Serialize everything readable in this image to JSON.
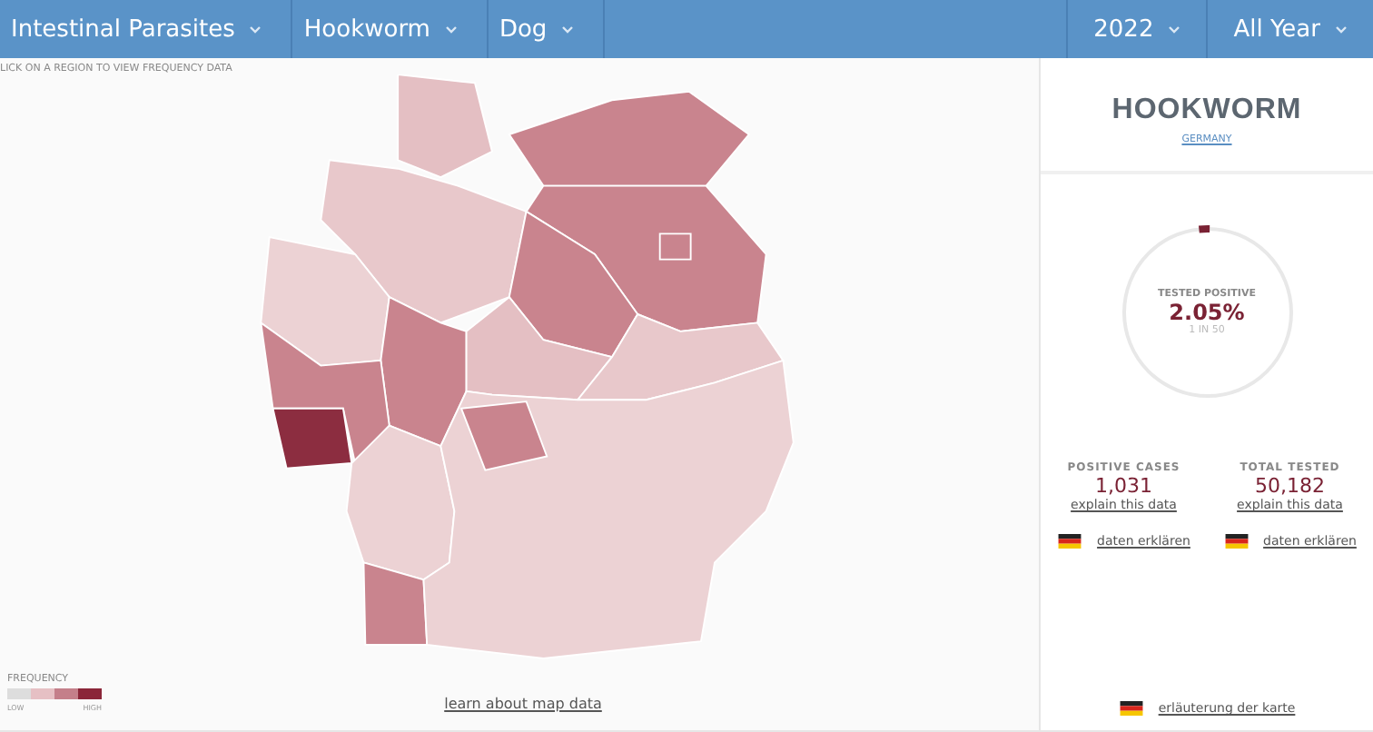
{
  "nav": {
    "left": [
      {
        "label": "Intestinal Parasites"
      },
      {
        "label": "Hookworm"
      },
      {
        "label": "Dog"
      }
    ],
    "right": [
      {
        "label": "2022"
      },
      {
        "label": "All Year"
      }
    ]
  },
  "map": {
    "instruction": "LICK ON A REGION TO VIEW FREQUENCY DATA",
    "regions": [
      {
        "color": "#e4bfc3"
      },
      {
        "color": "#c9848e"
      },
      {
        "color": "#e8c8cb"
      },
      {
        "color": "#c9848e"
      },
      {
        "color": "#c9848e"
      },
      {
        "color": "#c9848e"
      },
      {
        "color": "#ecd2d4"
      },
      {
        "color": "#c9848e"
      },
      {
        "color": "#e4bfc3"
      },
      {
        "color": "#e8c8cb"
      },
      {
        "color": "#c9848e"
      },
      {
        "color": "#8c2d40"
      },
      {
        "color": "#ecd2d4"
      },
      {
        "color": "#c9848e"
      },
      {
        "color": "#ecd2d4"
      },
      {
        "color": "#c9848e"
      }
    ],
    "legend": {
      "title": "FREQUENCY",
      "swatches": [
        {
          "color": "#dddddd"
        },
        {
          "color": "#e6c0c4"
        },
        {
          "color": "#c47f8a"
        },
        {
          "color": "#8b2639"
        }
      ],
      "low": "LOW",
      "high": "HIGH"
    },
    "link": "learn about map data"
  },
  "summary": {
    "title": "HOOKWORM",
    "region": "GERMANY",
    "gauge": {
      "label": "TESTED POSITIVE",
      "value": "2.05%",
      "ratio": "1 IN 50",
      "level": 0.0205
    },
    "stats": [
      {
        "label": "POSITIVE CASES",
        "value": "1,031",
        "link": "explain this data",
        "translation": "daten erklären"
      },
      {
        "label": "TOTAL TESTED",
        "value": "50,182",
        "link": "explain this data",
        "translation": "daten erklären"
      }
    ],
    "footer_link": "erläuterung der karte"
  }
}
